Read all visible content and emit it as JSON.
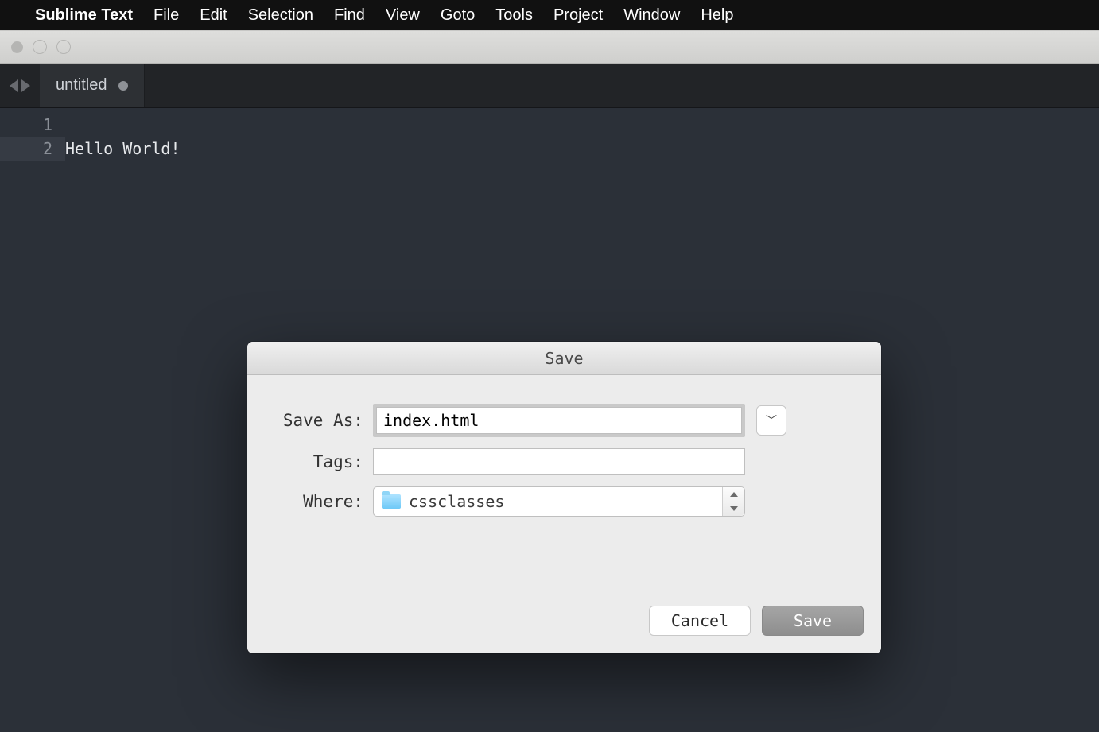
{
  "menubar": {
    "app_name": "Sublime Text",
    "items": [
      "File",
      "Edit",
      "Selection",
      "Find",
      "View",
      "Goto",
      "Tools",
      "Project",
      "Window",
      "Help"
    ]
  },
  "tab": {
    "title": "untitled"
  },
  "editor": {
    "lines": [
      {
        "num": "1",
        "text": ""
      },
      {
        "num": "2",
        "text": "Hello World!"
      }
    ],
    "current_line_index": 1
  },
  "dialog": {
    "title": "Save",
    "save_as_label": "Save As:",
    "save_as_value": "index.html",
    "tags_label": "Tags:",
    "tags_value": "",
    "where_label": "Where:",
    "where_value": "cssclasses",
    "cancel_label": "Cancel",
    "save_label": "Save"
  }
}
